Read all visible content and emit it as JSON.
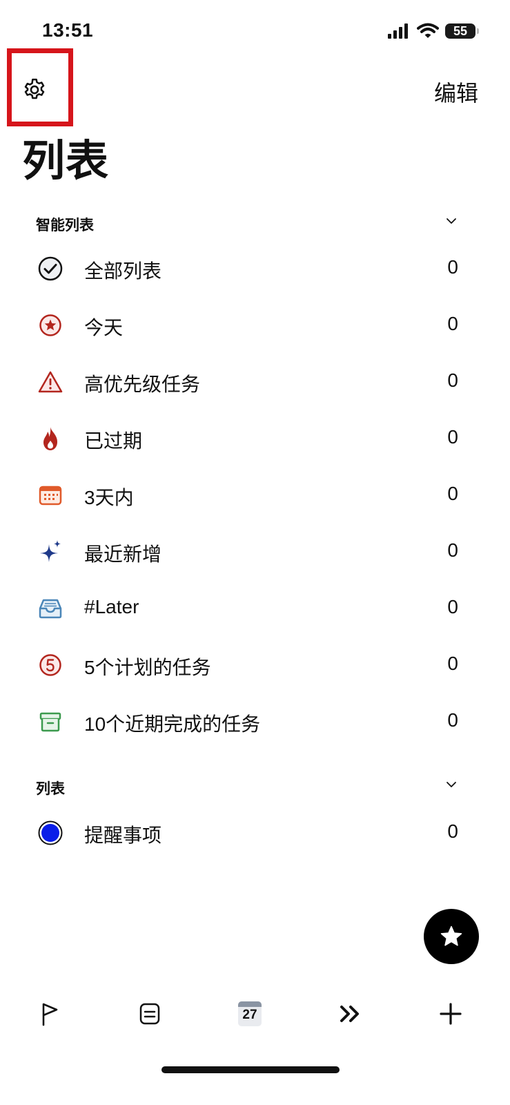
{
  "status_bar": {
    "time": "13:51",
    "battery": "55"
  },
  "header": {
    "edit_label": "编辑",
    "title": "列表"
  },
  "smart_section": {
    "title": "智能列表",
    "items": [
      {
        "label": "全部列表",
        "count": "0",
        "icon": "check-circle-icon"
      },
      {
        "label": "今天",
        "count": "0",
        "icon": "star-circle-icon"
      },
      {
        "label": "高优先级任务",
        "count": "0",
        "icon": "warning-triangle-icon"
      },
      {
        "label": "已过期",
        "count": "0",
        "icon": "flame-icon"
      },
      {
        "label": "3天内",
        "count": "0",
        "icon": "calendar-grid-icon"
      },
      {
        "label": "最近新增",
        "count": "0",
        "icon": "sparkles-icon"
      },
      {
        "label": "#Later",
        "count": "0",
        "icon": "inbox-tray-icon"
      },
      {
        "label": "5个计划的任务",
        "count": "0",
        "icon": "number-five-circle-icon"
      },
      {
        "label": "10个近期完成的任务",
        "count": "0",
        "icon": "archive-box-icon"
      }
    ]
  },
  "lists_section": {
    "title": "列表",
    "items": [
      {
        "label": "提醒事项",
        "count": "0",
        "icon": "blue-dot-icon"
      }
    ]
  },
  "tabbar": {
    "calendar_day": "27"
  },
  "colors": {
    "accent_red": "#b3261e",
    "blue_dot": "#0a1ee8",
    "highlight_border": "#d6151b"
  }
}
